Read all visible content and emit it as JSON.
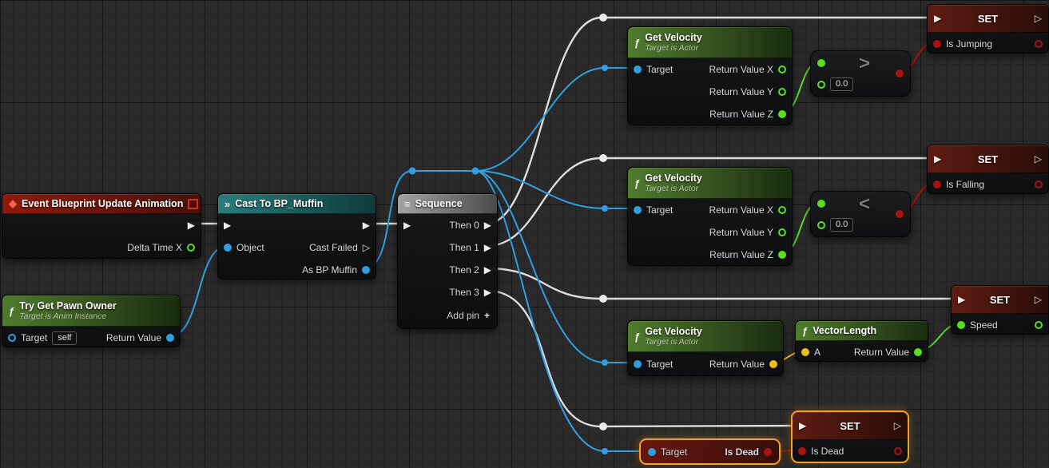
{
  "editor": {
    "type": "blueprint-graph"
  },
  "colors": {
    "background": "#2a2a2a",
    "exec_wire": "#dcdcdc",
    "object_pin": "#2f9fe0",
    "float_pin": "#59df1f",
    "bool_pin": "#a81414",
    "vector_pin": "#eebc1d",
    "selection": "#f0a02c",
    "event_header": "#8f1a0c",
    "function_header": "#507b2e",
    "cast_header": "#2a7d7d",
    "sequence_header": "#a3a3a3",
    "set_header": "#5e1c12"
  },
  "icons": {
    "event_icon": "◈",
    "function_icon": "ƒ",
    "cast_icon": "»",
    "sequence_icon": "≡",
    "exec_filled_icon": "▶",
    "exec_hollow_icon": "▷",
    "add_pin_icon": "+",
    "greater_icon": ">",
    "less_icon": "<"
  },
  "nodes": {
    "event_update_animation": {
      "title": "Event Blueprint Update Animation",
      "delta_time_label": "Delta Time X"
    },
    "try_get_pawn_owner": {
      "title": "Try Get Pawn Owner",
      "subtitle": "Target is Anim Instance",
      "target_label": "Target",
      "target_default": "self",
      "return_label": "Return Value"
    },
    "cast_to_bp_muffin": {
      "title": "Cast To BP_Muffin",
      "object_label": "Object",
      "cast_failed_label": "Cast Failed",
      "as_label": "As BP Muffin"
    },
    "sequence": {
      "title": "Sequence",
      "then_0": "Then 0",
      "then_1": "Then 1",
      "then_2": "Then 2",
      "then_3": "Then 3",
      "add_pin_label": "Add pin"
    },
    "get_velocity": {
      "title": "Get Velocity",
      "subtitle": "Target is Actor",
      "target_label": "Target",
      "return_x_label": "Return Value X",
      "return_y_label": "Return Value Y",
      "return_z_label": "Return Value Z",
      "return_label": "Return Value"
    },
    "greater_than": {
      "value": "0.0"
    },
    "less_than": {
      "value": "0.0"
    },
    "vector_length": {
      "title": "VectorLength",
      "a_label": "A",
      "return_label": "Return Value"
    },
    "set_is_jumping": {
      "header": "SET",
      "var_label": "Is Jumping"
    },
    "set_is_falling": {
      "header": "SET",
      "var_label": "Is Falling"
    },
    "set_speed": {
      "header": "SET",
      "var_label": "Speed"
    },
    "set_is_dead": {
      "header": "SET",
      "var_label": "Is Dead"
    },
    "get_is_dead": {
      "target_label": "Target",
      "var_label": "Is Dead"
    }
  }
}
